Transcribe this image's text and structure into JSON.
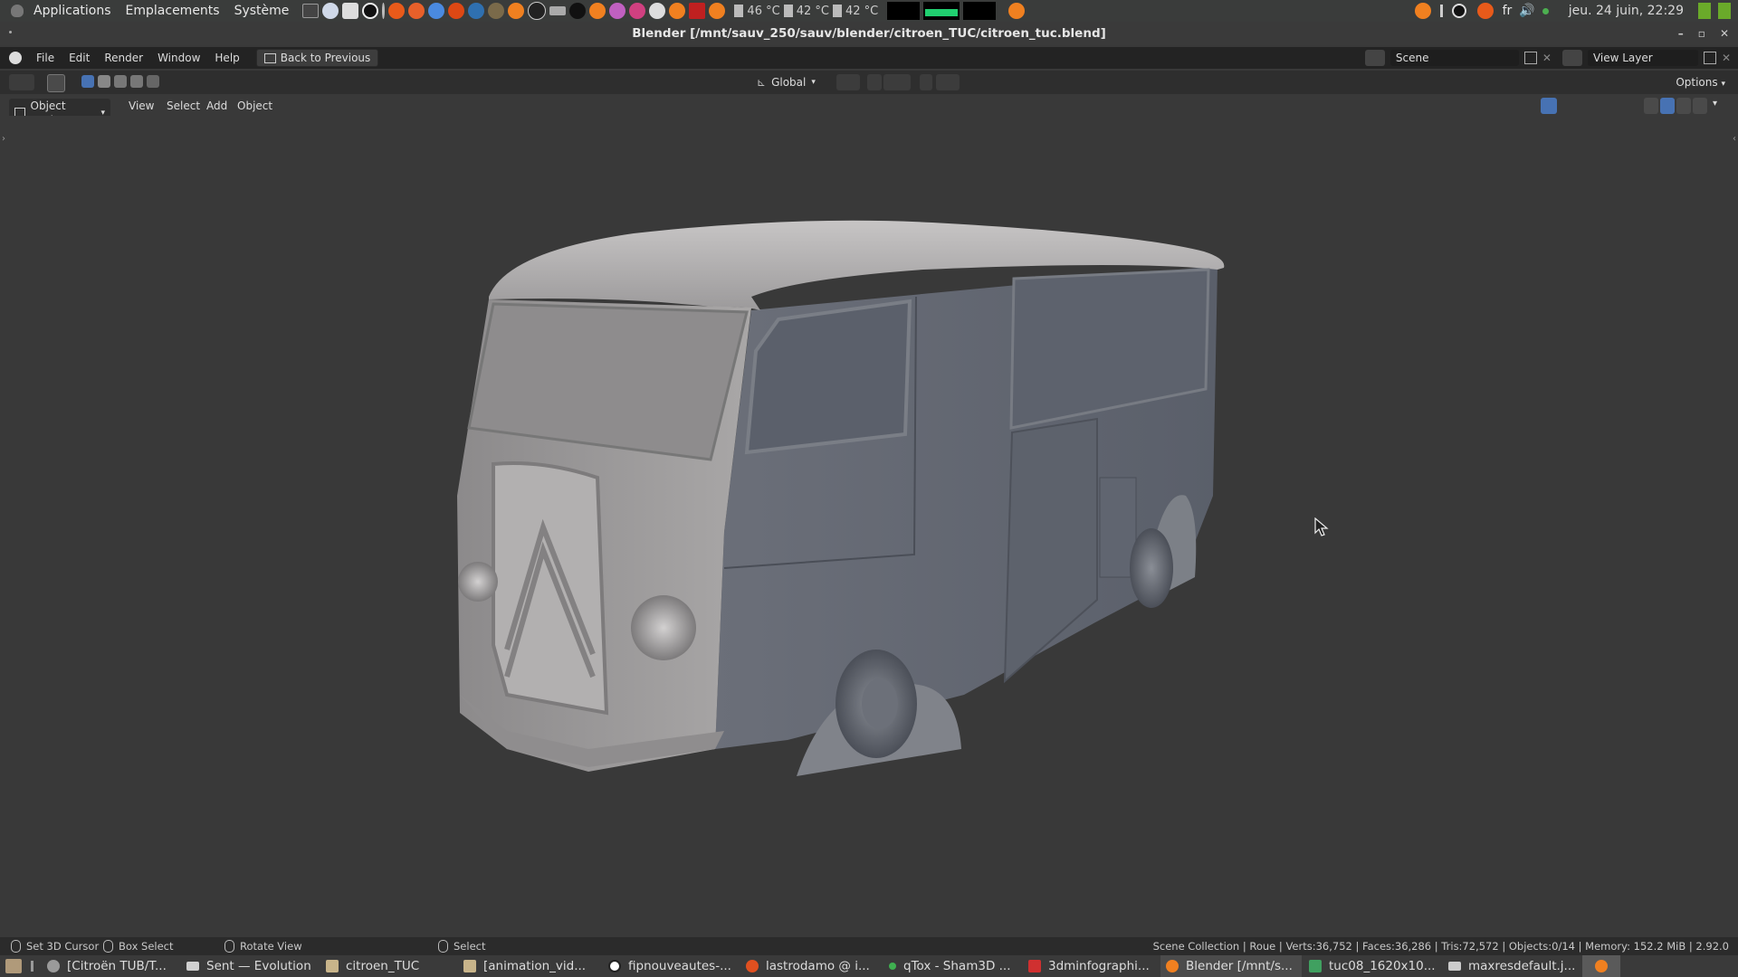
{
  "system_panel": {
    "menus": [
      "Applications",
      "Emplacements",
      "Système"
    ],
    "temperatures": [
      "46 °C",
      "42 °C",
      "42 °C"
    ],
    "language": "fr",
    "clock": "jeu. 24 juin, 22:29"
  },
  "window": {
    "title": "Blender [/mnt/sauv_250/sauv/blender/citroen_TUC/citroen_tuc.blend]"
  },
  "blender_topbar": {
    "menus": [
      "File",
      "Edit",
      "Render",
      "Window",
      "Help"
    ],
    "back_button": "Back to Previous",
    "scene": "Scene",
    "view_layer": "View Layer"
  },
  "tool_header": {
    "orientation": "Global",
    "options": "Options"
  },
  "view_header": {
    "mode": "Object Mode",
    "menus": [
      "View",
      "Select",
      "Add",
      "Object"
    ]
  },
  "statusbar": {
    "hints": [
      "Set 3D Cursor",
      "Box Select",
      "Rotate View",
      "Select"
    ],
    "info": "Scene Collection | Roue | Verts:36,752 | Faces:36,286 | Tris:72,572 | Objects:0/14 | Memory: 152.2 MiB | 2.92.0"
  },
  "taskbar": {
    "tasks": [
      {
        "label": "[Citroën TUB/T...",
        "color": "#9a9a9a"
      },
      {
        "label": "Sent — Evolution",
        "color": "#d0d0d0"
      },
      {
        "label": "citroen_TUC",
        "color": "#c8b48a"
      },
      {
        "label": "[animation_vid...",
        "color": "#c8b48a"
      },
      {
        "label": "fipnouveautes-...",
        "color": "#ffffff"
      },
      {
        "label": "lastrodamo @ i...",
        "color": "#e05020"
      },
      {
        "label": "qTox - Sham3D ...",
        "color": "#3fb050"
      },
      {
        "label": "3dminfographi...",
        "color": "#d03030"
      },
      {
        "label": "Blender [/mnt/s...",
        "color": "#f08020"
      },
      {
        "label": "tuc08_1620x10...",
        "color": "#40a060"
      },
      {
        "label": "maxresdefault.j...",
        "color": "#cccccc"
      }
    ]
  },
  "colors": {
    "accent_blue": "#4772b3",
    "blender_orange": "#f08020",
    "model_grey": "#8e9096"
  }
}
